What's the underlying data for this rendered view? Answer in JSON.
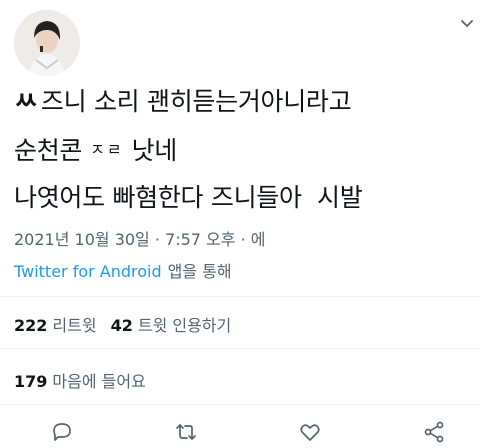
{
  "tweet": {
    "line1_prefix": "ㅆ",
    "line1_text": "즈니 소리 괜히듣는거아니라고",
    "line2_a": "순천콘",
    "line2_small": "ㅈㄹ",
    "line2_b": "낫네",
    "line3": "나엿어도 빠혐한다 즈니들아  시발"
  },
  "meta": {
    "timestamp": "2021년 10월 30일 · 7:57 오후 · 에",
    "source_link": "Twitter for Android",
    "source_suffix": "앱을 통해"
  },
  "stats": {
    "retweets": "222",
    "retweets_label": "리트윗",
    "quotes": "42",
    "quotes_label": "트윗 인용하기",
    "likes": "179",
    "likes_label": "마음에 들어요"
  },
  "icons": {
    "more": "chevron-down-icon",
    "reply": "reply-icon",
    "retweet": "retweet-icon",
    "like": "like-icon",
    "share": "share-icon"
  },
  "colors": {
    "link": "#1d9bf0",
    "secondary_text": "#536471",
    "primary_text": "#0f1419"
  }
}
